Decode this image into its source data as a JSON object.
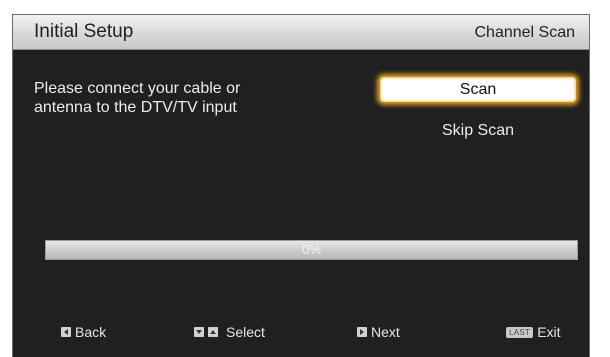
{
  "header": {
    "title": "Initial Setup",
    "screen_name": "Channel Scan"
  },
  "main": {
    "instruction_line1": "Please connect your cable or",
    "instruction_line2": "antenna to the DTV/TV input",
    "scan_button": "Scan",
    "skip_button": "Skip Scan",
    "progress": {
      "value_percent": 0,
      "label": "0%"
    }
  },
  "footer": {
    "back": {
      "label": "Back",
      "icon": "left-arrow-key-icon"
    },
    "select": {
      "label": "Select",
      "icons": [
        "down-arrow-key-icon",
        "up-arrow-key-icon"
      ]
    },
    "next": {
      "label": "Next",
      "icon": "right-arrow-key-icon"
    },
    "exit": {
      "label": "Exit",
      "key_label": "LAST"
    }
  },
  "colors": {
    "panel_background": "#202020",
    "header_background": "#d8d8d8",
    "focus_glow": "#e0a21c",
    "text_light": "#ececec"
  }
}
